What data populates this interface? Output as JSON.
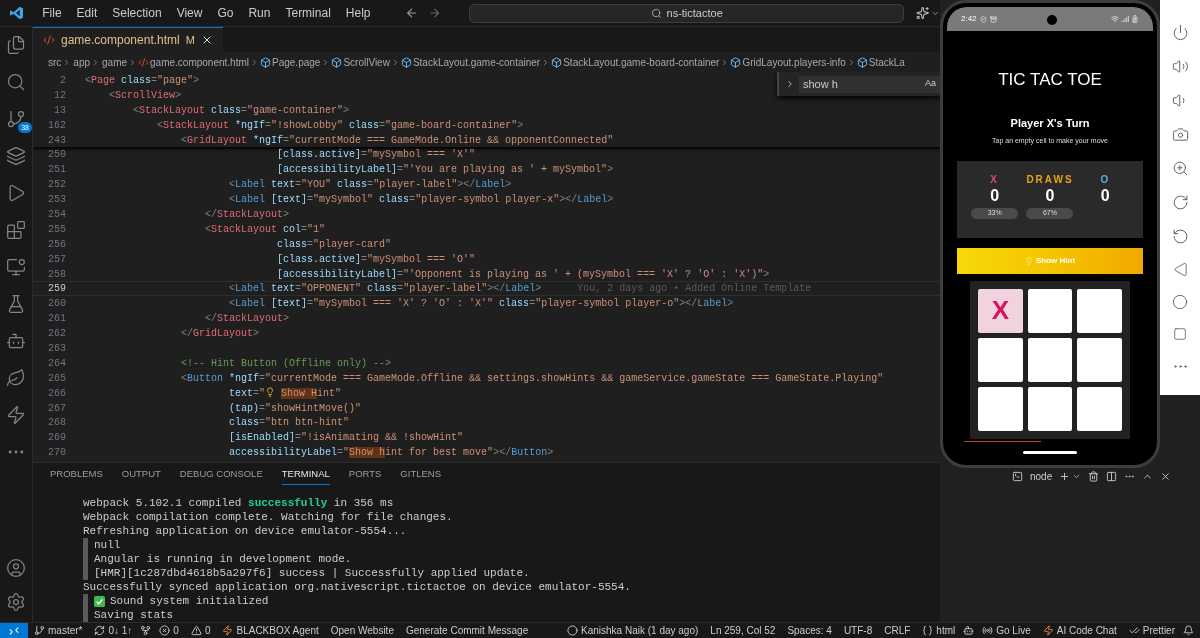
{
  "title_bar": {
    "menus": [
      "File",
      "Edit",
      "Selection",
      "View",
      "Go",
      "Run",
      "Terminal",
      "Help"
    ],
    "search": "ns-tictactoe"
  },
  "activity_bar": {
    "source_control_badge": "38"
  },
  "editor_tab": {
    "name": "game.component.html",
    "status": "M"
  },
  "breadcrumb": [
    {
      "kind": "folder",
      "text": "src"
    },
    {
      "kind": "folder",
      "text": "app"
    },
    {
      "kind": "folder",
      "text": "game"
    },
    {
      "kind": "file",
      "text": "game.component.html"
    },
    {
      "kind": "symbol",
      "text": "Page.page"
    },
    {
      "kind": "symbol",
      "text": "ScrollView"
    },
    {
      "kind": "symbol",
      "text": "StackLayout.game-container"
    },
    {
      "kind": "symbol",
      "text": "StackLayout.game-board-container"
    },
    {
      "kind": "symbol",
      "text": "GridLayout.players-info"
    },
    {
      "kind": "symbol",
      "text": "StackLa"
    }
  ],
  "find_widget": {
    "value": "show h",
    "toggle": "Aa"
  },
  "code_lines": [
    {
      "number": "2",
      "current": false,
      "tokens": [
        {
          "kind": "p",
          "t": "<"
        },
        {
          "kind": "tr",
          "t": "Page"
        },
        {
          "kind": "a",
          "t": " class"
        },
        {
          "kind": "p",
          "t": "="
        },
        {
          "kind": "s",
          "t": "\"page\""
        },
        {
          "kind": "p",
          "t": ">"
        }
      ]
    },
    {
      "number": "12",
      "current": false,
      "tokens": [
        {
          "kind": "p",
          "t": "    <"
        },
        {
          "kind": "tr",
          "t": "ScrollView"
        },
        {
          "kind": "p",
          "t": ">"
        }
      ]
    },
    {
      "number": "13",
      "current": false,
      "tokens": [
        {
          "kind": "p",
          "t": "        <"
        },
        {
          "kind": "tr",
          "t": "StackLayout"
        },
        {
          "kind": "a",
          "t": " class"
        },
        {
          "kind": "p",
          "t": "="
        },
        {
          "kind": "s",
          "t": "\"game-container\""
        },
        {
          "kind": "p",
          "t": ">"
        }
      ]
    },
    {
      "number": "162",
      "current": false,
      "tokens": [
        {
          "kind": "p",
          "t": "            <"
        },
        {
          "kind": "tr",
          "t": "StackLayout"
        },
        {
          "kind": "a",
          "t": " *ngIf"
        },
        {
          "kind": "p",
          "t": "="
        },
        {
          "kind": "s",
          "t": "\"!showLobby\""
        },
        {
          "kind": "a",
          "t": " class"
        },
        {
          "kind": "p",
          "t": "="
        },
        {
          "kind": "s",
          "t": "\"game-board-container\""
        },
        {
          "kind": "p",
          "t": ">"
        }
      ]
    },
    {
      "number": "243",
      "current": false,
      "tokens": [
        {
          "kind": "p",
          "t": "                <"
        },
        {
          "kind": "tr",
          "t": "GridLayout"
        },
        {
          "kind": "a",
          "t": " *ngIf"
        },
        {
          "kind": "p",
          "t": "="
        },
        {
          "kind": "s",
          "t": "\"currentMode === GameMode.Online && opponentConnected\""
        }
      ]
    },
    {
      "number": "250",
      "current": false,
      "tokens": [
        {
          "kind": "a",
          "t": "                                [class.active]"
        },
        {
          "kind": "p",
          "t": "="
        },
        {
          "kind": "s",
          "t": "\"mySymbol === 'X'\""
        }
      ]
    },
    {
      "number": "251",
      "current": false,
      "tokens": [
        {
          "kind": "a",
          "t": "                                [accessibilityLabel]"
        },
        {
          "kind": "p",
          "t": "="
        },
        {
          "kind": "s",
          "t": "\"'You are playing as ' + mySymbol\""
        },
        {
          "kind": "p",
          "t": ">"
        }
      ]
    },
    {
      "number": "252",
      "current": false,
      "tokens": [
        {
          "kind": "p",
          "t": "                        <"
        },
        {
          "kind": "tb",
          "t": "Label"
        },
        {
          "kind": "a",
          "t": " text"
        },
        {
          "kind": "p",
          "t": "="
        },
        {
          "kind": "s",
          "t": "\"YOU\""
        },
        {
          "kind": "a",
          "t": " class"
        },
        {
          "kind": "p",
          "t": "="
        },
        {
          "kind": "s",
          "t": "\"player-label\""
        },
        {
          "kind": "p",
          "t": "></"
        },
        {
          "kind": "tb",
          "t": "Label"
        },
        {
          "kind": "p",
          "t": ">"
        }
      ]
    },
    {
      "number": "253",
      "current": false,
      "tokens": [
        {
          "kind": "p",
          "t": "                        <"
        },
        {
          "kind": "tb",
          "t": "Label"
        },
        {
          "kind": "a",
          "t": " [text]"
        },
        {
          "kind": "p",
          "t": "="
        },
        {
          "kind": "s",
          "t": "\"mySymbol\""
        },
        {
          "kind": "a",
          "t": " class"
        },
        {
          "kind": "p",
          "t": "="
        },
        {
          "kind": "s",
          "t": "\"player-symbol player-x\""
        },
        {
          "kind": "p",
          "t": "></"
        },
        {
          "kind": "tb",
          "t": "Label"
        },
        {
          "kind": "p",
          "t": ">"
        }
      ]
    },
    {
      "number": "254",
      "current": false,
      "tokens": [
        {
          "kind": "p",
          "t": "                    </"
        },
        {
          "kind": "tr",
          "t": "StackLayout"
        },
        {
          "kind": "p",
          "t": ">"
        }
      ]
    },
    {
      "number": "255",
      "current": false,
      "tokens": [
        {
          "kind": "p",
          "t": "                    <"
        },
        {
          "kind": "tr",
          "t": "StackLayout"
        },
        {
          "kind": "a",
          "t": " col"
        },
        {
          "kind": "p",
          "t": "="
        },
        {
          "kind": "s",
          "t": "\"1\""
        }
      ]
    },
    {
      "number": "256",
      "current": false,
      "tokens": [
        {
          "kind": "a",
          "t": "                                class"
        },
        {
          "kind": "p",
          "t": "="
        },
        {
          "kind": "s",
          "t": "\"player-card\""
        }
      ]
    },
    {
      "number": "257",
      "current": false,
      "tokens": [
        {
          "kind": "a",
          "t": "                                [class.active]"
        },
        {
          "kind": "p",
          "t": "="
        },
        {
          "kind": "s",
          "t": "\"mySymbol === 'O'\""
        }
      ]
    },
    {
      "number": "258",
      "current": false,
      "tokens": [
        {
          "kind": "a",
          "t": "                                [accessibilityLabel]"
        },
        {
          "kind": "p",
          "t": "="
        },
        {
          "kind": "s",
          "t": "\"'Opponent is playing as ' + (mySymbol === 'X' ? 'O' : 'X')\""
        },
        {
          "kind": "p",
          "t": ">"
        }
      ]
    },
    {
      "number": "259",
      "current": true,
      "blame": "You, 2 days ago • Added Online Template",
      "tokens": [
        {
          "kind": "p",
          "t": "                        <"
        },
        {
          "kind": "tb",
          "t": "Label"
        },
        {
          "kind": "a",
          "t": " text"
        },
        {
          "kind": "p",
          "t": "="
        },
        {
          "kind": "s",
          "t": "\"OPPONENT\""
        },
        {
          "kind": "a",
          "t": " class"
        },
        {
          "kind": "p",
          "t": "="
        },
        {
          "kind": "s",
          "t": "\"player-label\""
        },
        {
          "kind": "p",
          "t": "></"
        },
        {
          "kind": "tb",
          "t": "Label"
        },
        {
          "kind": "p",
          "t": ">"
        }
      ]
    },
    {
      "number": "260",
      "current": false,
      "tokens": [
        {
          "kind": "p",
          "t": "                        <"
        },
        {
          "kind": "tb",
          "t": "Label"
        },
        {
          "kind": "a",
          "t": " [text]"
        },
        {
          "kind": "p",
          "t": "="
        },
        {
          "kind": "s",
          "t": "\"mySymbol === 'X' ? 'O' : 'X'\""
        },
        {
          "kind": "a",
          "t": " class"
        },
        {
          "kind": "p",
          "t": "="
        },
        {
          "kind": "s",
          "t": "\"player-symbol player-o\""
        },
        {
          "kind": "p",
          "t": "></"
        },
        {
          "kind": "tb",
          "t": "Label"
        },
        {
          "kind": "p",
          "t": ">"
        }
      ]
    },
    {
      "number": "261",
      "current": false,
      "tokens": [
        {
          "kind": "p",
          "t": "                    </"
        },
        {
          "kind": "tr",
          "t": "StackLayout"
        },
        {
          "kind": "p",
          "t": ">"
        }
      ]
    },
    {
      "number": "262",
      "current": false,
      "tokens": [
        {
          "kind": "p",
          "t": "                </"
        },
        {
          "kind": "tr",
          "t": "GridLayout"
        },
        {
          "kind": "p",
          "t": ">"
        }
      ]
    },
    {
      "number": "263",
      "current": false
    },
    {
      "number": "264",
      "current": false,
      "tokens": [
        {
          "kind": "c",
          "t": "                <!-- Hint Button (Offline only) -->"
        }
      ]
    },
    {
      "number": "265",
      "current": false,
      "tokens": [
        {
          "kind": "p",
          "t": "                <"
        },
        {
          "kind": "tb",
          "t": "Button"
        },
        {
          "kind": "a",
          "t": " *ngIf"
        },
        {
          "kind": "p",
          "t": "="
        },
        {
          "kind": "s",
          "t": "\"currentMode === GameMode.Offline && settings.showHints && gameService.gameState === GameState.Playing\""
        }
      ]
    },
    {
      "number": "266",
      "current": false,
      "tokens": [
        {
          "kind": "a",
          "t": "                        text"
        },
        {
          "kind": "p",
          "t": "="
        },
        {
          "kind": "s",
          "t": "\""
        },
        {
          "kind": "bulb"
        },
        {
          "kind": "m",
          "t": "Show H"
        },
        {
          "kind": "s",
          "t": "int\""
        }
      ]
    },
    {
      "number": "267",
      "current": false,
      "tokens": [
        {
          "kind": "a",
          "t": "                        (tap)"
        },
        {
          "kind": "p",
          "t": "="
        },
        {
          "kind": "s",
          "t": "\"showHintMove()\""
        }
      ]
    },
    {
      "number": "268",
      "current": false,
      "tokens": [
        {
          "kind": "a",
          "t": "                        class"
        },
        {
          "kind": "p",
          "t": "="
        },
        {
          "kind": "s",
          "t": "\"btn btn-hint\""
        }
      ]
    },
    {
      "number": "269",
      "current": false,
      "tokens": [
        {
          "kind": "a",
          "t": "                        [isEnabled]"
        },
        {
          "kind": "p",
          "t": "="
        },
        {
          "kind": "s",
          "t": "\"!isAnimating && !showHint\""
        }
      ]
    },
    {
      "number": "270",
      "current": false,
      "tokens": [
        {
          "kind": "a",
          "t": "                        accessibilityLabel"
        },
        {
          "kind": "p",
          "t": "="
        },
        {
          "kind": "s",
          "t": "\""
        },
        {
          "kind": "m",
          "t": "Show h"
        },
        {
          "kind": "s",
          "t": "int for best move\""
        },
        {
          "kind": "p",
          "t": "></"
        },
        {
          "kind": "tb",
          "t": "Button"
        },
        {
          "kind": "p",
          "t": ">"
        }
      ]
    }
  ],
  "panel_tabs": [
    {
      "label": "PROBLEMS",
      "selected": false
    },
    {
      "label": "OUTPUT",
      "selected": false
    },
    {
      "label": "DEBUG CONSOLE",
      "selected": false
    },
    {
      "label": "TERMINAL",
      "selected": true
    },
    {
      "label": "PORTS",
      "selected": false
    },
    {
      "label": "GITLENS",
      "selected": false
    }
  ],
  "terminal_name": "node",
  "terminal_lines": [
    {
      "kind": "plain",
      "text": "webpack 5.102.1 compiled **successfully** in 356 ms"
    },
    {
      "kind": "plain",
      "text": "Webpack compilation complete. Watching for file changes."
    },
    {
      "kind": "plain",
      "text": "Refreshing application on device emulator-5554..."
    },
    {
      "kind": "group",
      "text": "null"
    },
    {
      "kind": "group",
      "text": "Angular is running in development mode."
    },
    {
      "kind": "group",
      "text": "[HMR][1c287dbd4618b5a297f6] success | Successfully applied update."
    },
    {
      "kind": "plain",
      "text": "Successfully synced application org.nativescript.tictactoe on device emulator-5554."
    },
    {
      "kind": "group-check",
      "text": "Sound system initialized"
    },
    {
      "kind": "group",
      "text": "Saving stats"
    }
  ],
  "status_bar": {
    "left": [
      {
        "kind": "branch",
        "text": "master*"
      },
      {
        "kind": "sync",
        "text": "0↓ 1↑"
      },
      {
        "kind": "graph"
      },
      {
        "kind": "errors",
        "text": "0"
      },
      {
        "kind": "warnings",
        "text": "0"
      },
      {
        "kind": "bolt",
        "text": "BLACKBOX Agent"
      },
      {
        "kind": "plain",
        "text": "Open Website"
      },
      {
        "kind": "plain",
        "text": "Generate Commit Message"
      }
    ],
    "right": [
      {
        "kind": "blame",
        "text": "Kanishka Naik (1 day ago)"
      },
      {
        "kind": "plain",
        "text": "Ln 259, Col 52"
      },
      {
        "kind": "plain",
        "text": "Spaces: 4"
      },
      {
        "kind": "plain",
        "text": "UTF-8"
      },
      {
        "kind": "plain",
        "text": "CRLF"
      },
      {
        "kind": "braces",
        "text": "html"
      },
      {
        "kind": "copilot"
      },
      {
        "kind": "live",
        "text": "Go Live"
      },
      {
        "kind": "bolt",
        "text": "AI Code Chat"
      },
      {
        "kind": "check",
        "text": "Prettier"
      },
      {
        "kind": "bell"
      }
    ]
  },
  "phone": {
    "time": "2:42",
    "title": "TIC TAC TOE",
    "turn": "Player X's Turn",
    "instruction": "Tap an empty cell to make your move",
    "scores": [
      {
        "label": "X",
        "score": "0",
        "percent": "33%",
        "color": "#e0457b"
      },
      {
        "label": "DRAWS",
        "score": "0",
        "percent": "67%",
        "color": "#e8a317"
      },
      {
        "label": "O",
        "score": "0",
        "color": "#4fb3d9"
      }
    ],
    "hint_button": "Show Hint",
    "cells": [
      {
        "kind": "x",
        "mark": "X"
      },
      {
        "kind": "empty"
      },
      {
        "kind": "empty"
      },
      {
        "kind": "empty"
      },
      {
        "kind": "empty"
      },
      {
        "kind": "empty"
      },
      {
        "kind": "empty"
      },
      {
        "kind": "empty"
      },
      {
        "kind": "empty"
      }
    ]
  }
}
